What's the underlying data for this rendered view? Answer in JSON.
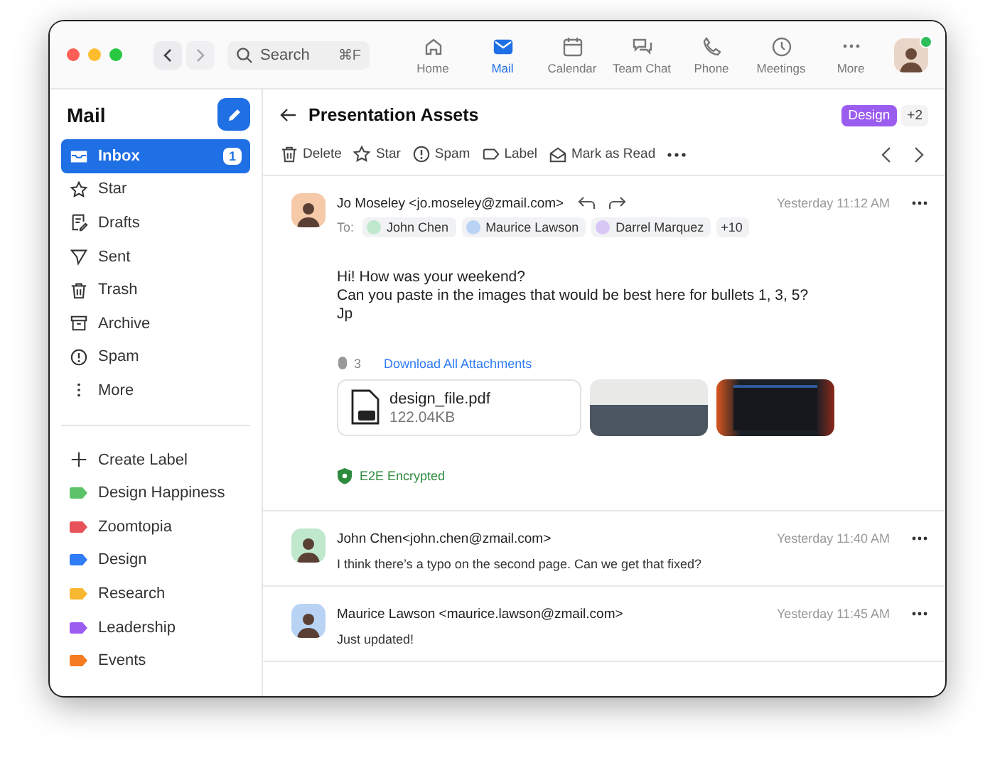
{
  "window": {
    "search": {
      "placeholder": "Search",
      "shortcut": "⌘F"
    },
    "nav": [
      {
        "label": "Home",
        "selected": false
      },
      {
        "label": "Mail",
        "selected": true
      },
      {
        "label": "Calendar",
        "selected": false
      },
      {
        "label": "Team Chat",
        "selected": false
      },
      {
        "label": "Phone",
        "selected": false
      },
      {
        "label": "Meetings",
        "selected": false
      },
      {
        "label": "More",
        "selected": false
      }
    ],
    "status_online": true
  },
  "sidebar": {
    "title": "Mail",
    "items": [
      {
        "label": "Inbox",
        "selected": true,
        "count": "1"
      },
      {
        "label": "Star",
        "selected": false
      },
      {
        "label": "Drafts",
        "selected": false
      },
      {
        "label": "Sent",
        "selected": false
      },
      {
        "label": "Trash",
        "selected": false
      },
      {
        "label": "Archive",
        "selected": false
      },
      {
        "label": "Spam",
        "selected": false
      },
      {
        "label": "More",
        "selected": false
      }
    ],
    "create_label": "Create Label",
    "labels": [
      {
        "label": "Design Happiness",
        "color": "#5cc36a"
      },
      {
        "label": "Zoomtopia",
        "color": "#e8525b"
      },
      {
        "label": "Design",
        "color": "#2f7cf6"
      },
      {
        "label": "Research",
        "color": "#f7b731"
      },
      {
        "label": "Leadership",
        "color": "#9b5cf0"
      },
      {
        "label": "Events",
        "color": "#f57c20"
      }
    ]
  },
  "thread": {
    "subject": "Presentation Assets",
    "tag": {
      "label": "Design",
      "color": "#9b5cf0"
    },
    "more_tags": "+2",
    "toolbar": [
      "Delete",
      "Star",
      "Spam",
      "Label",
      "Mark as Read"
    ],
    "messages": [
      {
        "sender": "Jo Moseley <jo.moseley@zmail.com>",
        "time": "Yesterday 11:12 AM",
        "expanded": true,
        "to_label": "To:",
        "recipients": [
          "John Chen",
          "Maurice Lawson",
          "Darrel Marquez"
        ],
        "more_recipients": "+10",
        "body": [
          "Hi! How was your weekend?",
          "Can you paste in the images that would be best here for bullets 1, 3, 5?",
          "Jp"
        ],
        "attachment_count": "3",
        "download_all": "Download All Attachments",
        "file": {
          "name": "design_file.pdf",
          "size": "122.04KB"
        },
        "encryption": "E2E Encrypted"
      },
      {
        "sender": "John Chen<john.chen@zmail.com>",
        "time": "Yesterday 11:40 AM",
        "expanded": false,
        "body": [
          "I think there’s a typo on the second page. Can we get that fixed?"
        ]
      },
      {
        "sender": "Maurice Lawson <maurice.lawson@zmail.com>",
        "time": "Yesterday 11:45 AM",
        "expanded": false,
        "body": [
          "Just updated!"
        ]
      }
    ]
  }
}
